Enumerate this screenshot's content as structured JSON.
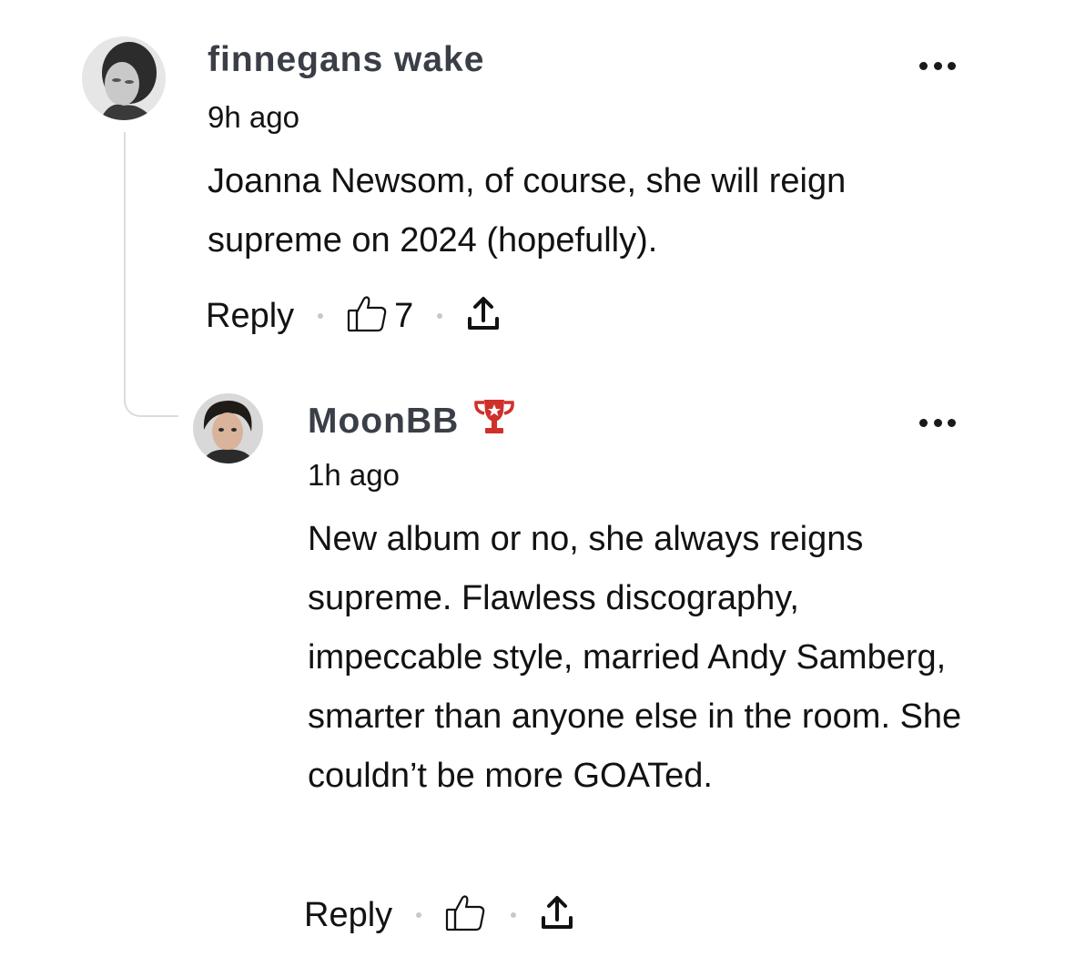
{
  "comments": [
    {
      "author": "finnegans wake",
      "time": "9h ago",
      "text": "Joanna Newsom, of course, she will reign supreme on 2024 (hopefully).",
      "reply_label": "Reply",
      "likes": "7",
      "avatar_icon": "avatar-photo"
    },
    {
      "author": "MoonBB",
      "badge_icon": "trophy-icon",
      "badge_color": "#d0302a",
      "time": "1h ago",
      "text": "New album or no, she always reigns supreme. Flawless discography, impeccable style, married Andy Samberg, smarter than anyone else in the room. She couldn’t be more GOATed.",
      "reply_label": "Reply",
      "avatar_icon": "avatar-photo"
    }
  ]
}
